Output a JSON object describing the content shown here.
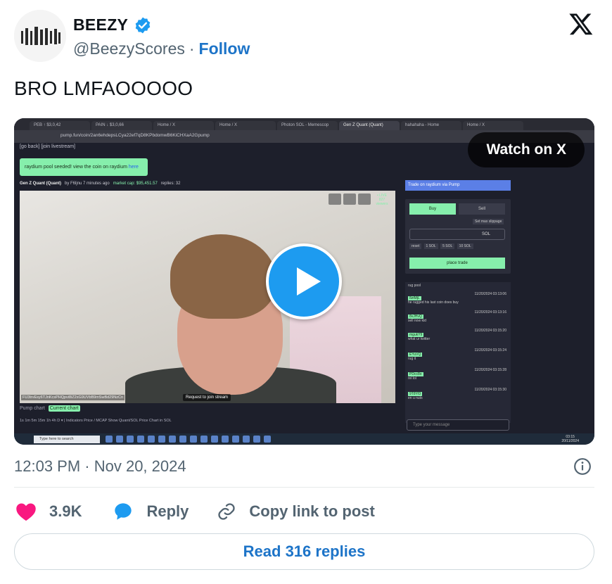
{
  "author": {
    "display_name": "BEEZY",
    "handle": "@BeezyScores",
    "separator": "·",
    "follow_label": "Follow",
    "verified": true
  },
  "tweet": {
    "text": "BRO LMFAOOOOO",
    "timestamp": "12:03 PM · Nov 20, 2024"
  },
  "media": {
    "overlay_label": "Watch on X",
    "browser_tabs": [
      "PEB ↑ $3,0,42",
      "PAIN ↓ $3,0,66",
      "Home / X",
      "Home / X",
      "Photon SOL - Memescop",
      "Gen Z Quant (Quant)",
      "hahahaha - Home",
      "Home / X"
    ],
    "url": "pump.fun/coin/2an6ehdepsLCya22ef7qD8KPbdomwB6KiCHXaA2Gpump",
    "go_back": "[go back]   [join livestream]",
    "banner_text": "raydium pool seeded! view the coin on raydium",
    "banner_link": "here",
    "coin_name": "Gen Z Quant (Quant)",
    "coin_meta": "by  F6ljnu  7 minutes ago",
    "market_cap": "market cap: $95,451.57",
    "replies": "replies: 32",
    "mint_address": "FU3trvEsy6TJnKcsPHQpvi8iZ2xG9UVbB9mSwBd29NzCn",
    "join_stream": "Request to join stream",
    "live_label": "• LIVE",
    "viewers": "827 viewers",
    "chart_label": "Pump chart",
    "current_chart": "Current chart",
    "chart_tools": "1s   1m   5m   15m   1h   4h   D  ▾    |    Indicators    Price / MCAP    Show Quant/SOL Price Chart in SOL",
    "trade_header": "Trade on raydium via Pump",
    "buy_label": "Buy",
    "sell_label": "Sell",
    "slippage_label": "Set max slippage",
    "amount_placeholder": "0.0",
    "currency": "SOL",
    "presets": [
      "reset",
      "1 SOL",
      "5 SOL",
      "10 SOL"
    ],
    "place_trade": "place trade",
    "chat_messages": [
      {
        "user": "",
        "time": "",
        "text": "rug pool"
      },
      {
        "user": "8ztMjL",
        "time": "11/20/2024 03:13:06",
        "text": "he rugged his last coin does buy"
      },
      {
        "user": "8vJHvQ",
        "time": "11/20/2024 03:13:16",
        "text": "sell now kid"
      },
      {
        "user": "mgukY9",
        "time": "11/20/2024 03:15:20",
        "text": "what ur twitter"
      },
      {
        "user": "EYuVQ",
        "time": "11/20/2024 03:15:24",
        "text": "rug it"
      },
      {
        "user": "PDcc8o",
        "time": "11/20/2024 03:15:28",
        "text": "rel lol"
      },
      {
        "user": "9T8Yf3",
        "time": "11/20/2024 03:15:30",
        "text": "en u nuts"
      }
    ],
    "chat_placeholder": "Type your message",
    "taskbar_search": "Type here to search",
    "clock_time": "03:15",
    "clock_date": "20/11/2024"
  },
  "engagement": {
    "like_count": "3.9K",
    "reply_label": "Reply",
    "copy_label": "Copy link to post",
    "read_replies": "Read 316 replies"
  },
  "colors": {
    "accent": "#1d9bf0",
    "link": "#1d74c8",
    "like": "#f91880",
    "text_secondary": "#536471"
  },
  "icons": {
    "verified": "verified-badge-icon",
    "logo": "x-logo-icon",
    "play": "play-icon",
    "info": "info-icon",
    "like": "heart-icon",
    "reply": "speech-bubble-icon",
    "copy": "link-icon"
  }
}
